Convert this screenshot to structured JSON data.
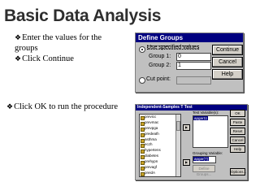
{
  "slide": {
    "title": "Basic Data Analysis",
    "bullets": [
      "Enter the values for the",
      "groups",
      "Click Continue"
    ],
    "bullet_ok": "Click OK to run the procedure"
  },
  "define_groups": {
    "title": "Define Groups",
    "use_specified_values": "Use specified values",
    "group1_label": "Group 1:",
    "group1_value": "0",
    "group2_label": "Group 2:",
    "group2_value": "1",
    "cut_point_label": "Cut point:",
    "cut_point_value": "",
    "buttons": {
      "continue": "Continue",
      "cancel": "Cancel",
      "help": "Help"
    }
  },
  "ttest": {
    "title": "Independent-Samples T Test",
    "variables": [
      "previcc",
      "prevmac",
      "prevpga",
      "predeath",
      "asthma",
      "eczh",
      "hypertens",
      "diabetes",
      "prehypn",
      "prevagf",
      "preidA"
    ],
    "test_variables_label": "Test Variable(s):",
    "test_variable": "apgar11",
    "grouping_variable_label": "Grouping Variable:",
    "grouping_variable": "apgar(?)",
    "define_groups_button": "Define Groups...",
    "buttons": {
      "ok": "OK",
      "paste": "Paste",
      "reset": "Reset",
      "cancel": "Cancel",
      "help": "Help",
      "options": "Options..."
    }
  },
  "icons": {
    "bullet": "arrow-bullet-icon",
    "move": "right-arrow-icon"
  }
}
